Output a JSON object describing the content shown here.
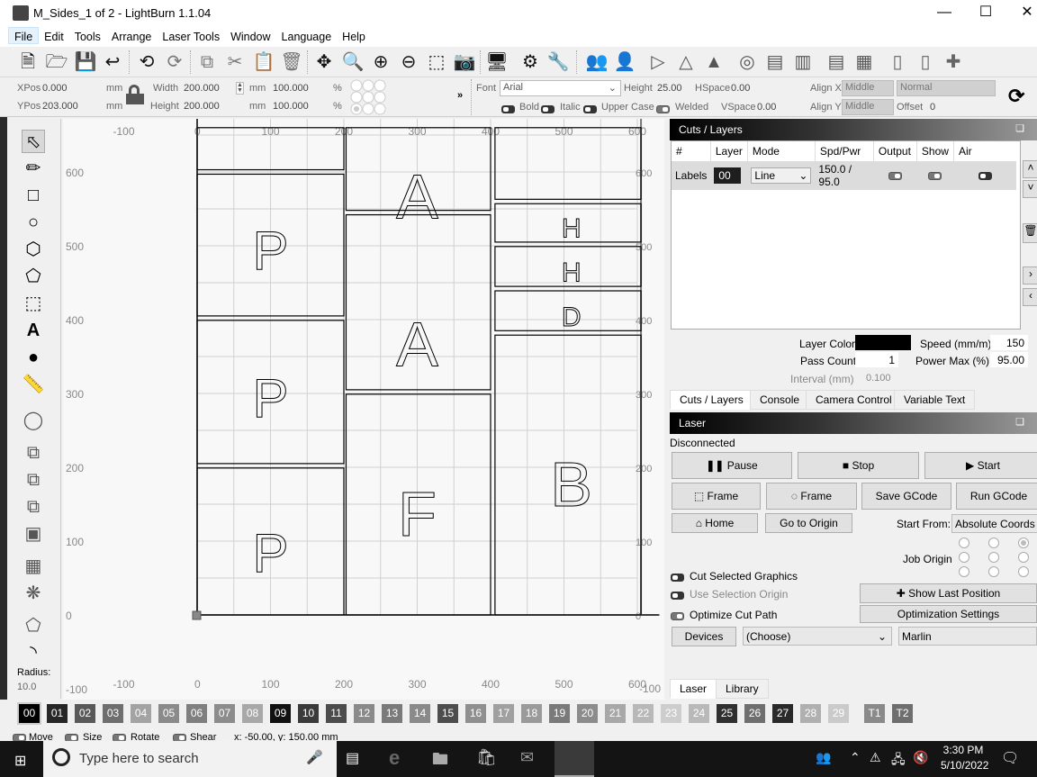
{
  "window": {
    "title": "M_Sides_1 of 2 - LightBurn 1.1.04",
    "controls": [
      "minimize",
      "maximize",
      "close"
    ]
  },
  "menu": [
    "File",
    "Edit",
    "Tools",
    "Arrange",
    "Laser Tools",
    "Window",
    "Language",
    "Help"
  ],
  "toolbar": {
    "icons": [
      "new-file",
      "open-folder",
      "save",
      "import",
      "undo",
      "redo",
      "copy",
      "cut",
      "paste",
      "delete",
      "move",
      "zoom-to-page",
      "zoom-in",
      "zoom-out",
      "frame-selection",
      "camera",
      "monitor",
      "settings",
      "tools",
      "group",
      "ungroup",
      "flip-h",
      "mirror",
      "flip-diagonal",
      "center",
      "align-top",
      "align-middle",
      "align-bottom",
      "align-left",
      "distribute-h",
      "distribute-v",
      "crosshair"
    ]
  },
  "props": {
    "xpos_label": "XPos",
    "xpos": "0.000",
    "ypos_label": "YPos",
    "ypos": "203.000",
    "unit": "mm",
    "width_label": "Width",
    "width": "200.000",
    "height_label": "Height",
    "height": "200.000",
    "scale_w": "100.000",
    "scale_h": "100.000",
    "pct": "%",
    "more": "»",
    "font_label": "Font",
    "font": "Arial",
    "text_height_label": "Height",
    "text_height": "25.00",
    "hspace_label": "HSpace",
    "hspace": "0.00",
    "vspace_label": "VSpace",
    "vspace": "0.00",
    "alignx_label": "Align X",
    "alignx": "Middle",
    "aligny_label": "Align Y",
    "aligny": "Middle",
    "style": "Normal",
    "offset_label": "Offset",
    "offset": "0",
    "bold": "Bold",
    "italic": "Italic",
    "upper": "Upper Case",
    "welded": "Welded"
  },
  "left_tools": [
    "select",
    "draw-lines",
    "rectangle",
    "ellipse",
    "polygon",
    "edit-polygon",
    "position-laser",
    "text",
    "marker",
    "measure",
    "offset",
    "weld",
    "union",
    "subtract",
    "intersect",
    "grid-array",
    "circular-array",
    "node-edit",
    "corner-radius"
  ],
  "radius": {
    "label": "Radius:",
    "value": "10.0"
  },
  "canvas": {
    "x_ticks": [
      "-100",
      "0",
      "100",
      "200",
      "300",
      "400",
      "500",
      "600"
    ],
    "y_ticks": [
      "600",
      "500",
      "400",
      "300",
      "200",
      "100",
      "0",
      "-100"
    ],
    "right_y_ticks": [
      "600",
      "500",
      "400",
      "300",
      "200",
      "100",
      "0",
      "-100"
    ],
    "bottom_x_ticks": [
      "-100",
      "0",
      "100",
      "200",
      "300",
      "400",
      "500",
      "600"
    ],
    "letters": [
      "A",
      "P",
      "H",
      "H",
      "D",
      "A",
      "P",
      "F",
      "B",
      "P"
    ]
  },
  "cuts": {
    "title": "Cuts / Layers",
    "columns": [
      "#",
      "Layer",
      "Mode",
      "Spd/Pwr",
      "Output",
      "Show",
      "Air"
    ],
    "rows": [
      {
        "num": "Labels",
        "layer": "00",
        "mode": "Line",
        "spdpwr": "150.0 / 95.0",
        "output": true,
        "show": true,
        "air": false
      }
    ],
    "layer_color_label": "Layer Color",
    "speed_label": "Speed (mm/m)",
    "speed": "150",
    "pass_label": "Pass Count",
    "pass": "1",
    "power_label": "Power Max (%)",
    "power": "95.00",
    "interval_label": "Interval (mm)",
    "interval": "0.100",
    "layer_color": "#000000"
  },
  "tabs_top": [
    "Cuts / Layers",
    "Console",
    "Camera Control",
    "Variable Text"
  ],
  "laser": {
    "title": "Laser",
    "status": "Disconnected",
    "pause": "Pause",
    "stop": "Stop",
    "start": "Start",
    "frame1": "Frame",
    "frame2": "Frame",
    "save_gcode": "Save GCode",
    "run_gcode": "Run GCode",
    "home": "Home",
    "go_origin": "Go to Origin",
    "start_from_label": "Start From:",
    "start_from": "Absolute Coords",
    "job_origin_label": "Job Origin",
    "job_origin_selected": 2,
    "cut_selected": "Cut Selected Graphics",
    "use_sel_origin": "Use Selection Origin",
    "optimize": "Optimize Cut Path",
    "show_last": "Show Last Position",
    "opt_settings": "Optimization Settings",
    "devices": "Devices",
    "device_choose": "(Choose)",
    "device_type": "Marlin"
  },
  "tabs_bottom": [
    "Laser",
    "Library"
  ],
  "palette": [
    {
      "l": "00",
      "c": "#000000"
    },
    {
      "l": "01",
      "c": "#262626"
    },
    {
      "l": "02",
      "c": "#595959"
    },
    {
      "l": "03",
      "c": "#6e6e6e"
    },
    {
      "l": "04",
      "c": "#a3a3a3"
    },
    {
      "l": "05",
      "c": "#8a8a8a"
    },
    {
      "l": "06",
      "c": "#7f7f7f"
    },
    {
      "l": "07",
      "c": "#8c8c8c"
    },
    {
      "l": "08",
      "c": "#a8a8a8"
    },
    {
      "l": "09",
      "c": "#111111"
    },
    {
      "l": "10",
      "c": "#3a3a3a"
    },
    {
      "l": "11",
      "c": "#4c4c4c"
    },
    {
      "l": "12",
      "c": "#8a8a8a"
    },
    {
      "l": "13",
      "c": "#7a7a7a"
    },
    {
      "l": "14",
      "c": "#8a8a8a"
    },
    {
      "l": "15",
      "c": "#4d4d4d"
    },
    {
      "l": "16",
      "c": "#8f8f8f"
    },
    {
      "l": "17",
      "c": "#a0a0a0"
    },
    {
      "l": "18",
      "c": "#9a9a9a"
    },
    {
      "l": "19",
      "c": "#7a7a7a"
    },
    {
      "l": "20",
      "c": "#8c8c8c"
    },
    {
      "l": "21",
      "c": "#a8a8a8"
    },
    {
      "l": "22",
      "c": "#b8b8b8"
    },
    {
      "l": "23",
      "c": "#cdcdcd"
    },
    {
      "l": "24",
      "c": "#b9b9b9"
    },
    {
      "l": "25",
      "c": "#303030"
    },
    {
      "l": "26",
      "c": "#6f6f6f"
    },
    {
      "l": "27",
      "c": "#2a2a2a"
    },
    {
      "l": "28",
      "c": "#b0b0b0"
    },
    {
      "l": "29",
      "c": "#cacaca"
    },
    {
      "l": "T1",
      "c": "#8a8a8a"
    },
    {
      "l": "T2",
      "c": "#6e6e6e"
    }
  ],
  "status": {
    "move": "Move",
    "size": "Size",
    "rotate": "Rotate",
    "shear": "Shear",
    "coords": "x: -50.00, y: 150.00 mm"
  },
  "taskbar": {
    "search_placeholder": "Type here to search",
    "time": "3:30 PM",
    "date": "5/10/2022"
  }
}
